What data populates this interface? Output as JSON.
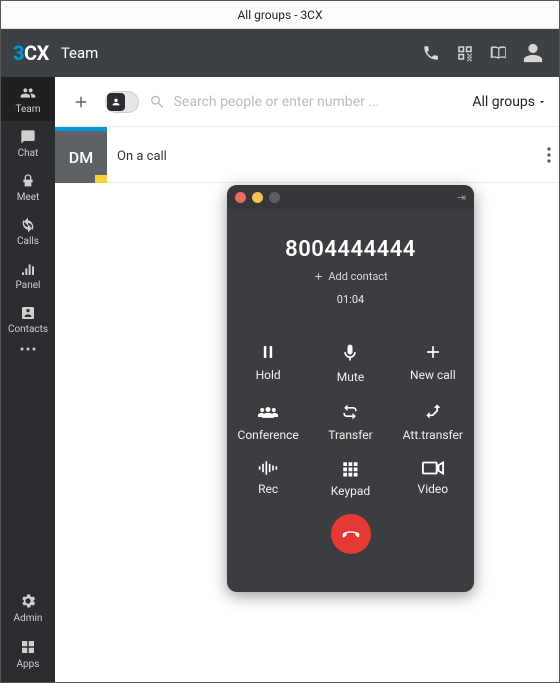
{
  "window": {
    "title": "All groups - 3CX"
  },
  "header": {
    "team_label": "Team"
  },
  "sidebar": {
    "items": [
      {
        "label": "Team"
      },
      {
        "label": "Chat"
      },
      {
        "label": "Meet"
      },
      {
        "label": "Calls"
      },
      {
        "label": "Panel"
      },
      {
        "label": "Contacts"
      },
      {
        "label": "Admin"
      },
      {
        "label": "Apps"
      }
    ]
  },
  "toolbar": {
    "search_placeholder": "Search people or enter number ...",
    "groups_label": "All groups"
  },
  "contact_row": {
    "initials": "DM",
    "status": "On a call"
  },
  "call": {
    "number": "8004444444",
    "add_contact_label": "Add contact",
    "timer": "01:04",
    "buttons": {
      "hold": "Hold",
      "mute": "Mute",
      "newcall": "New call",
      "conference": "Conference",
      "transfer": "Transfer",
      "atttransfer": "Att.transfer",
      "rec": "Rec",
      "keypad": "Keypad",
      "video": "Video"
    }
  }
}
